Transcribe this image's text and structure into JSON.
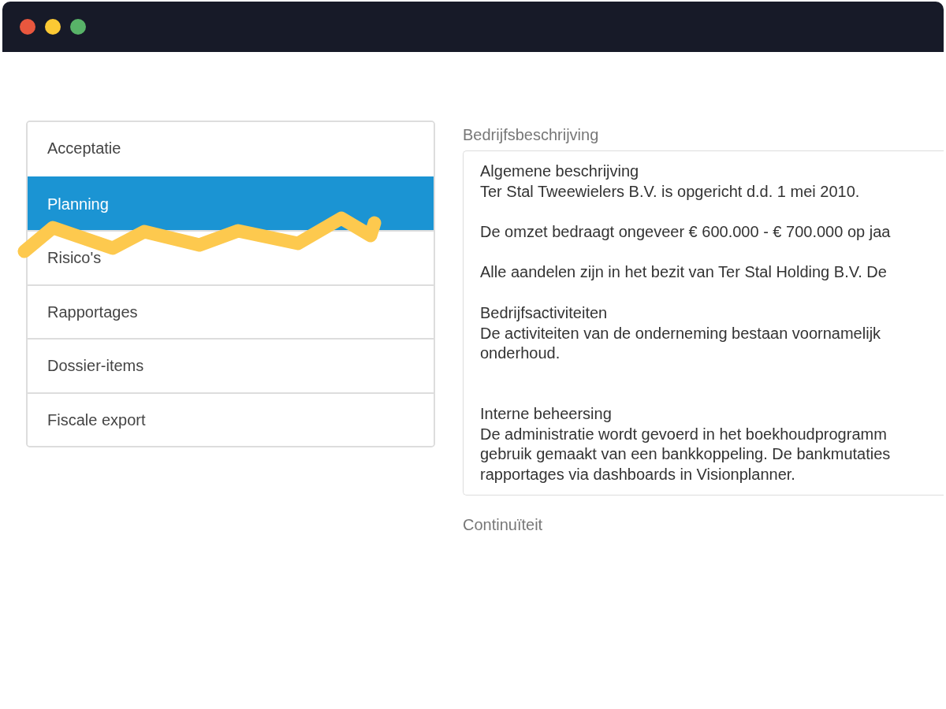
{
  "menu": [
    {
      "label": "Acceptatie",
      "selected": false
    },
    {
      "label": "Planning",
      "selected": true
    },
    {
      "label": "Risico's",
      "selected": false
    },
    {
      "label": "Rapportages",
      "selected": false
    },
    {
      "label": "Dossier-items",
      "selected": false
    },
    {
      "label": "Fiscale export",
      "selected": false
    }
  ],
  "fields": [
    {
      "label": "Bedrijfsbeschrijving",
      "sections": [
        {
          "heading": "Algemene beschrijving",
          "paragraphs": [
            [
              "Ter Stal Tweewielers B.V. is opgericht d.d. 1 mei 2010."
            ],
            [
              "De omzet bedraagt ongeveer € 600.000 - € 700.000 op jaa"
            ],
            [
              "Alle aandelen zijn in het bezit van Ter Stal Holding B.V. De"
            ]
          ]
        },
        {
          "heading": "Bedrijfsactiviteiten",
          "paragraphs": [
            [
              "De activiteiten van de onderneming bestaan voornamelijk",
              "onderhoud."
            ]
          ]
        },
        {
          "heading": "Interne beheersing",
          "paragraphs": [
            [
              "De administratie wordt gevoerd in het boekhoudprogramm",
              "gebruik gemaakt van een bankkoppeling. De bankmutaties",
              "rapportages via dashboards in Visionplanner."
            ]
          ]
        }
      ]
    },
    {
      "label": "Continuïteit"
    }
  ]
}
